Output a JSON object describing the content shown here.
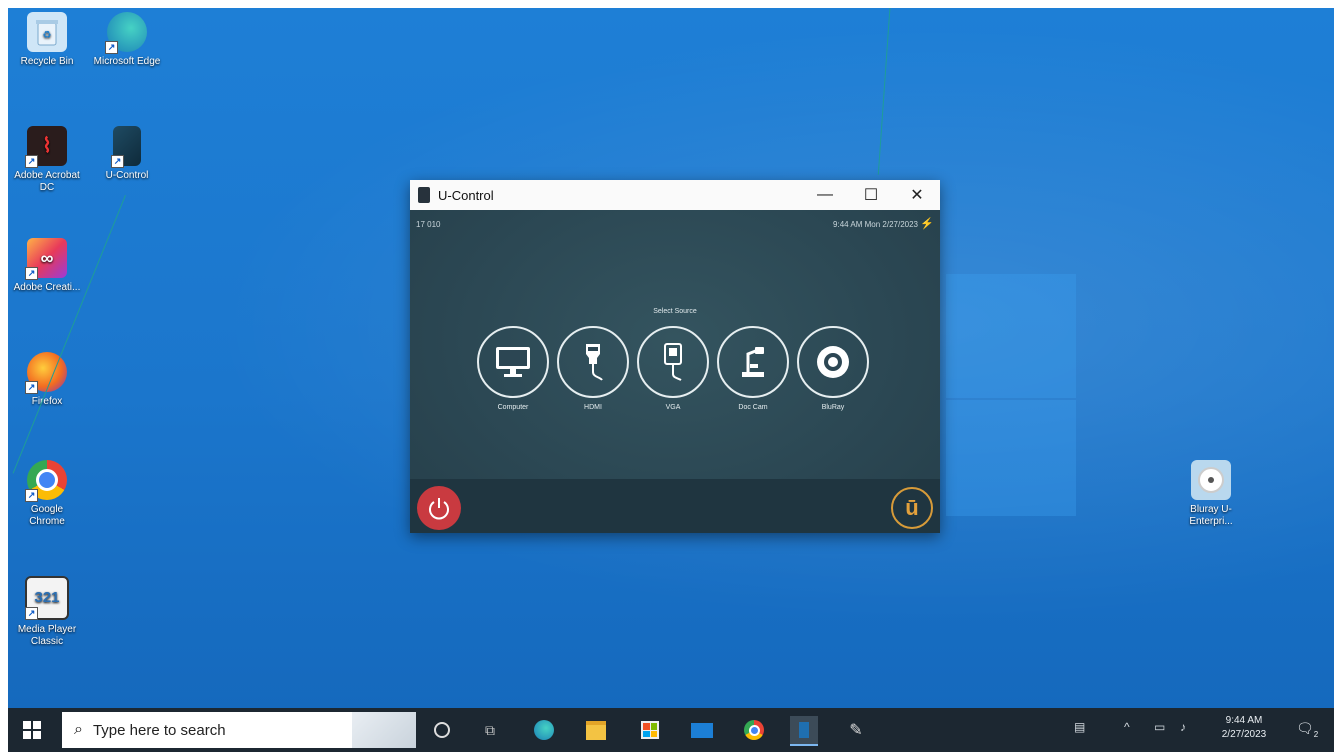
{
  "desktop": {
    "icons": [
      {
        "label": "Recycle Bin",
        "icon": "recycle-bin-icon",
        "color": "#cfe6f7"
      },
      {
        "label": "Microsoft Edge",
        "icon": "edge-icon",
        "color": "#1aa6a0"
      },
      {
        "label": "Adobe Acrobat DC",
        "icon": "acrobat-icon",
        "color": "#2a1c1c"
      },
      {
        "label": "U-Control",
        "icon": "u-control-icon",
        "color": "#1f4b63"
      },
      {
        "label": "Adobe Creati...",
        "icon": "creative-cloud-icon",
        "color": "#e83a5a"
      },
      {
        "label": "Firefox",
        "icon": "firefox-icon",
        "color": "#f26b21"
      },
      {
        "label": "Google Chrome",
        "icon": "chrome-icon",
        "color": "#4caf50"
      },
      {
        "label": "Media Player Classic",
        "icon": "media-player-icon",
        "color": "#2b6fb3"
      },
      {
        "label": "Bluray U-Enterpri...",
        "icon": "bluray-icon",
        "color": "#b9d8ee"
      }
    ]
  },
  "window": {
    "title": "U-Control",
    "minimize": "—",
    "maximize": "☐",
    "close": "✕",
    "room": "17 010",
    "datetime": "9:44 AM   Mon 2/27/2023",
    "select_source": "Select Source",
    "sources": [
      {
        "label": "Computer",
        "icon": "monitor-icon"
      },
      {
        "label": "HDMI",
        "icon": "hdmi-icon"
      },
      {
        "label": "VGA",
        "icon": "vga-icon"
      },
      {
        "label": "Doc Cam",
        "icon": "doc-cam-icon"
      },
      {
        "label": "BluRay",
        "icon": "disc-icon"
      }
    ],
    "logo_letter": "ū"
  },
  "taskbar": {
    "search_placeholder": "Type here to search",
    "time": "9:44 AM",
    "date": "2/27/2023",
    "notification_count": "2"
  },
  "colors": {
    "desktop": "#1e7fd6",
    "window_panel": "#2c4653",
    "power": "#c93a40",
    "logo_accent": "#d79b39",
    "taskbar": "#1c2731",
    "annotation": "#1f9d98"
  }
}
